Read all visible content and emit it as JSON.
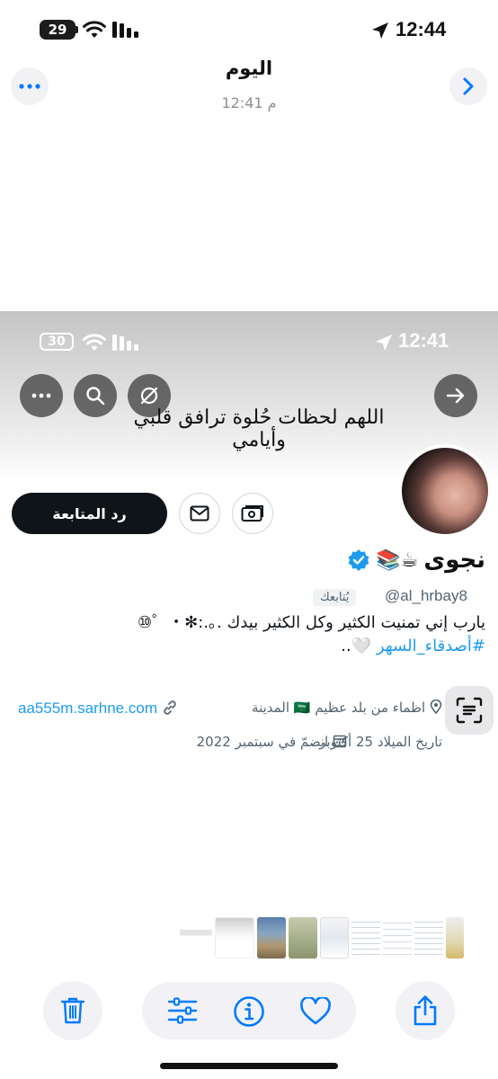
{
  "status_bar": {
    "time": "12:44",
    "battery": "29"
  },
  "header": {
    "title": "اليوم",
    "subtitle": "12:41 م"
  },
  "screenshot": {
    "status_bar": {
      "time": "12:41",
      "battery": "30"
    },
    "banner_text": "اللهم لحظات حُلوة ترافق قلبي وأيامي",
    "profile": {
      "name": "نجوى",
      "name_emoji": "☕📚",
      "handle": "@al_hrbay8",
      "follows_you": "يُتابعك",
      "follow_back_label": "رد المتابعة",
      "bio_line1": "يارب إني تمنيت الكثير وكل الكثير بيدك .｡.:✻・゜⑩",
      "bio_hashtag": "#أصدقاء_السهر",
      "bio_line2_suffix": "🤍..",
      "location": "اظماء من بلد عظيم 🇸🇦 المدينة",
      "website": "aa555m.sarhne.com",
      "birthday": "تاريخ الميلاد 25 أكتوبر",
      "joined": "انضمّ في سبتمبر 2022"
    }
  },
  "colors": {
    "accent": "#1d9bf0",
    "ios_blue": "#007aff",
    "follow_button": "#0f1419"
  },
  "toolbar": {
    "icons": [
      "trash-icon",
      "adjust-icon",
      "info-icon",
      "heart-icon",
      "share-icon"
    ]
  }
}
